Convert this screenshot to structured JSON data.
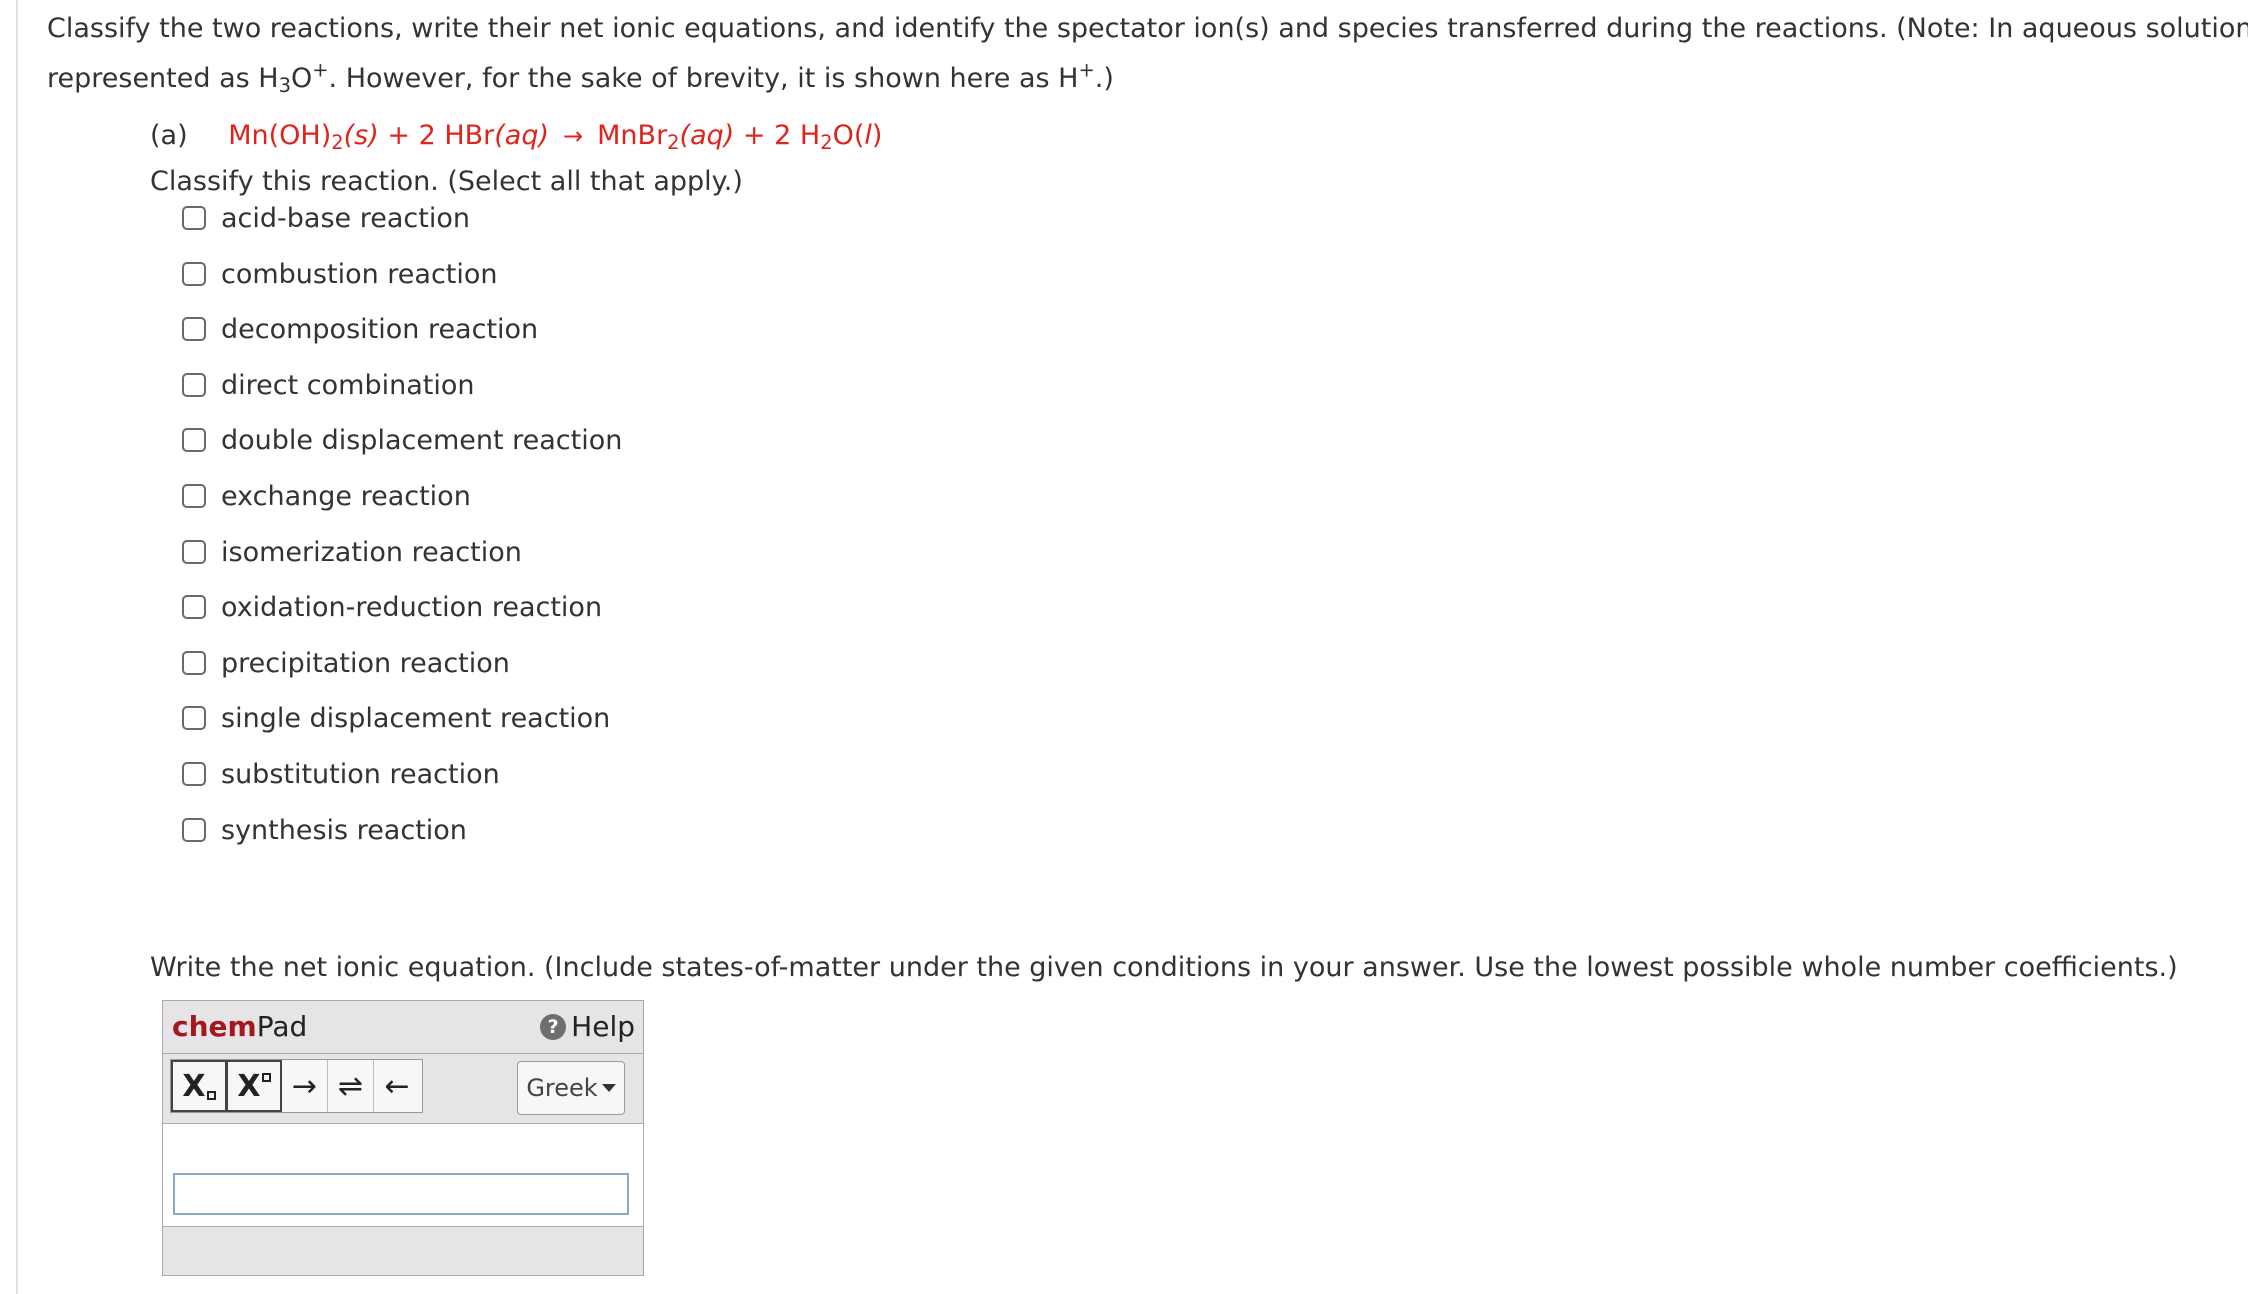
{
  "instructions": {
    "line1": "Classify the two reactions, write their net ionic equations, and identify the spectator ion(s) and species transferred during the reactions. (Note: In aqueous solution, H",
    "line1_sup": "+",
    "line2_a": "represented as H",
    "line2_sub": "3",
    "line2_b": "O",
    "line2_sup": "+",
    "line2_c": ". However, for the sake of brevity, it is shown here as H",
    "line2_sup2": "+",
    "line2_d": ".)"
  },
  "part_a": {
    "label": "(a)",
    "equation": {
      "r1": "Mn(OH)",
      "r1_sub": "2",
      "r1_state": "(s)",
      "plus1": "+ 2 HBr",
      "r2_state": "(aq)",
      "arrow": "→",
      "p1": "MnBr",
      "p1_sub": "2",
      "p1_state": "(aq)",
      "plus2": "+ 2 H",
      "p2_sub": "2",
      "p2_o": "O(",
      "p2_state": "l",
      "p2_close": ")"
    },
    "classify_label": "Classify this reaction. (Select all that apply.)",
    "options": [
      "acid-base reaction",
      "combustion reaction",
      "decomposition reaction",
      "direct combination",
      "double displacement reaction",
      "exchange reaction",
      "isomerization reaction",
      "oxidation-reduction reaction",
      "precipitation reaction",
      "single displacement reaction",
      "substitution reaction",
      "synthesis reaction"
    ],
    "net_ionic_label": "Write the net ionic equation. (Include states-of-matter under the given conditions in your answer. Use the lowest possible whole number coefficients.)"
  },
  "chempad": {
    "title_bold": "chem",
    "title_rest": "Pad",
    "help_label": "Help",
    "help_icon": "help-icon",
    "toolbar": {
      "subscript_label": "X",
      "superscript_label": "X",
      "arrow_right": "→",
      "equilibrium": "⇌",
      "arrow_left": "←",
      "greek_label": "Greek"
    },
    "input_value": ""
  },
  "colors": {
    "equation_red": "#e0241b",
    "chem_brand": "#a3181f",
    "input_border": "#8aa8c6"
  }
}
